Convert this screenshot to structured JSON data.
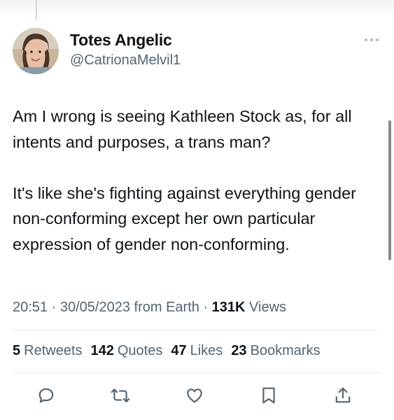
{
  "tweet": {
    "display_name": "Totes Angelic",
    "handle": "@CatrionaMelvil1",
    "body": "Am I wrong is seeing Kathleen Stock as, for all intents and purposes, a trans man?\n\nIt's like she's fighting against everything gender non-conforming except her own particular expression of gender non-conforming.",
    "time": "20:51",
    "date": "30/05/2023",
    "source": "from Earth",
    "views_count": "131K",
    "views_label": "Views"
  },
  "stats": {
    "retweets_count": "5",
    "retweets_label": "Retweets",
    "quotes_count": "142",
    "quotes_label": "Quotes",
    "likes_count": "47",
    "likes_label": "Likes",
    "bookmarks_count": "23",
    "bookmarks_label": "Bookmarks"
  },
  "actions": {
    "icons": [
      "reply-icon",
      "retweet-icon",
      "like-icon",
      "bookmark-icon",
      "share-icon"
    ]
  },
  "colors": {
    "text": "#0f1419",
    "secondary": "#536471",
    "divider": "#e6ecf0"
  }
}
